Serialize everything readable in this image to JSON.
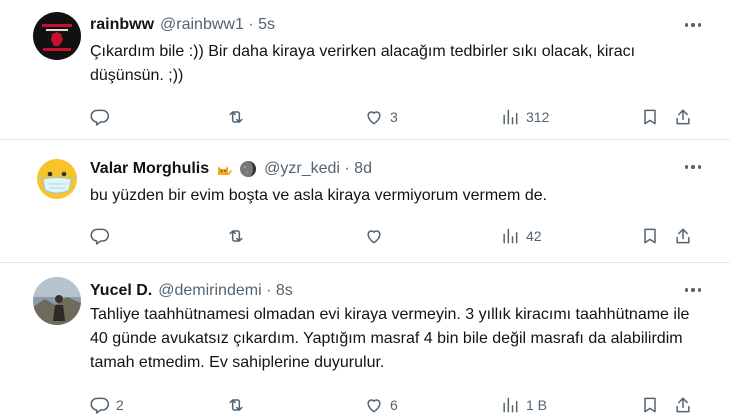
{
  "tweets": [
    {
      "name": "rainbww",
      "handle": "@rainbww1 · 5s",
      "text": "Çıkardım bile :)) Bir daha kiraya verirken alacağım tedbirler sıkı olacak, kiracı düşünsün. ;))",
      "replies": "",
      "retweets": "",
      "likes": "3",
      "views": "312"
    },
    {
      "name": "Valar Morghulis",
      "name_emojis": [
        "cat-emoji",
        "moon-emoji"
      ],
      "handle": "@yzr_kedi · 8d",
      "text": "bu yüzden bir evim boşta ve asla kiraya vermiyorum vermem de.",
      "replies": "",
      "retweets": "",
      "likes": "",
      "views": "42"
    },
    {
      "name": "Yucel D.",
      "handle": "@demirindemi · 8s",
      "text": "Tahliye taahhütnamesi olmadan evi kiraya vermeyin. 3 yıllık kiracımı taahhütname ile 40 günde avukatsız çıkardım. Yaptığım masraf 4 bin bile değil masrafı da alabilirdim tamah etmedim. Ev sahiplerine duyurulur.",
      "replies": "2",
      "retweets": "",
      "likes": "6",
      "views": "1 B"
    }
  ],
  "colors": {
    "text": "#0f1419",
    "muted": "#536471",
    "divider": "#e6e9ec"
  }
}
